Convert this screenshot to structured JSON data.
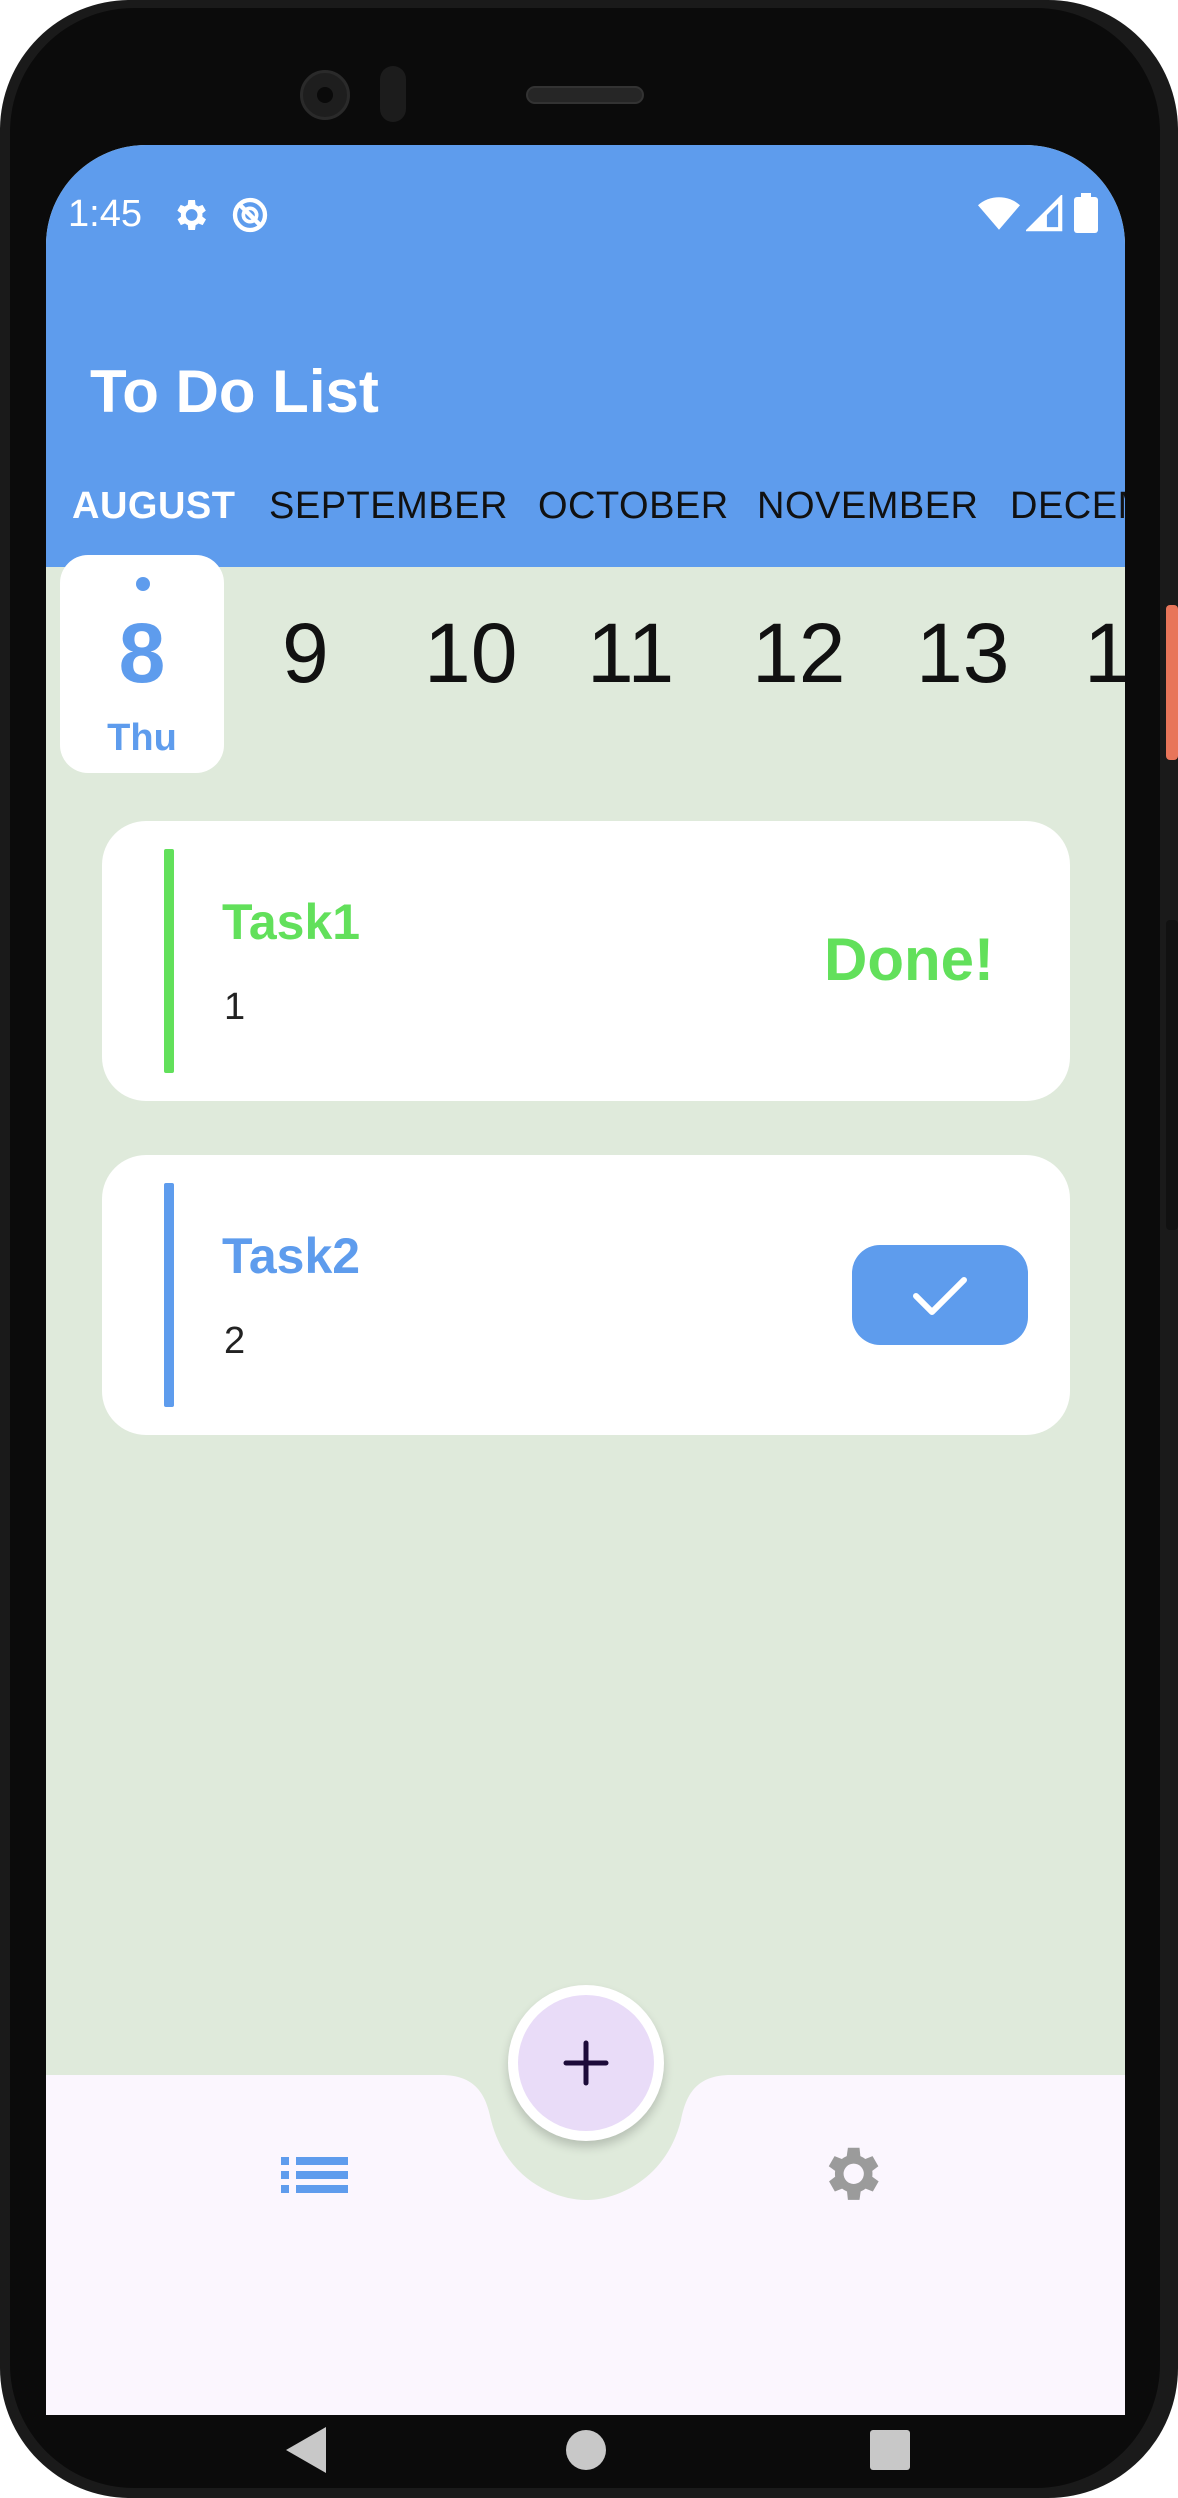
{
  "status_bar": {
    "time": "1:45",
    "left_icons": [
      "gear-icon",
      "no-sync-icon"
    ],
    "right_icons": [
      "wifi-icon",
      "cellular-icon",
      "battery-icon"
    ]
  },
  "app_bar": {
    "title": "To Do List",
    "background_color": "#5e9ced"
  },
  "months": [
    {
      "label": "AUGUST",
      "active": true
    },
    {
      "label": "SEPTEMBER",
      "active": false
    },
    {
      "label": "OCTOBER",
      "active": false
    },
    {
      "label": "NOVEMBER",
      "active": false
    },
    {
      "label": "DECEM",
      "active": false
    }
  ],
  "days": {
    "selected": {
      "number": "8",
      "weekday": "Thu"
    },
    "others": [
      "9",
      "10",
      "11",
      "12",
      "13",
      "1"
    ]
  },
  "tasks": [
    {
      "title": "Task1",
      "note": "1",
      "status_label": "Done!",
      "completed": true,
      "color": "#62e05b"
    },
    {
      "title": "Task2",
      "note": "2",
      "completed": false,
      "color": "#5e9ced"
    }
  ],
  "bottom_nav": {
    "items": [
      "list-icon",
      "settings-icon"
    ],
    "fab_icon": "plus-icon"
  },
  "colors": {
    "accent": "#5e9ced",
    "done_green": "#62e05b",
    "page_background": "#dfeadb",
    "bottom_bar": "#fbf6fe",
    "fab": "#e9dcf8"
  },
  "system_nav": [
    "back-icon",
    "home-icon",
    "recents-icon"
  ]
}
